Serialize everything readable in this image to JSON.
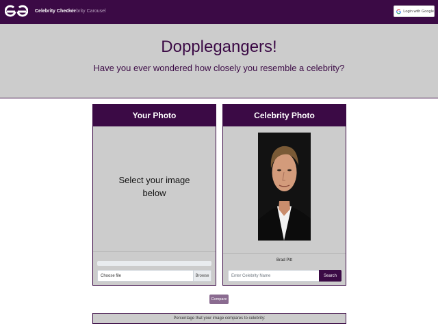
{
  "navbar": {
    "logo_icon": "gfg-logo-icon",
    "brand": "Celebrity Checker",
    "link": "Celebrity Carousel",
    "login_label": "Login with Google",
    "login_icon": "google-icon"
  },
  "hero": {
    "title": "Dopplegangers!",
    "subtitle": "Have you ever wondered how closely you resemble a celebrity?"
  },
  "your_photo": {
    "header": "Your Photo",
    "placeholder_line1": "Select your image",
    "placeholder_line2": "below",
    "progress": 0,
    "file_label": "Choose file",
    "browse_label": "Browse"
  },
  "celebrity_photo": {
    "header": "Celebrity Photo",
    "name": "Brad Pitt",
    "search_placeholder": "Enter Celebrity Name",
    "search_label": "Search"
  },
  "compare_label": "Compare",
  "result_text": "Percentage that your image compares to celebrity:",
  "colors": {
    "primary": "#3b0a45",
    "panel": "#cccccc",
    "compare_button": "#8a6b90"
  }
}
